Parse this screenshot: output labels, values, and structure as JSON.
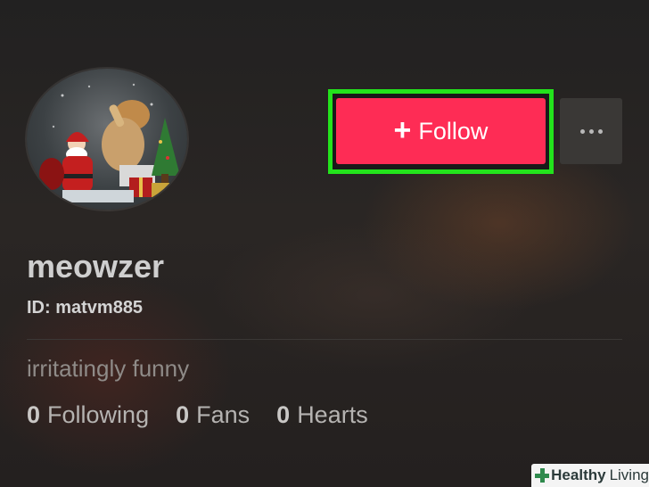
{
  "profile": {
    "username": "meowzer",
    "id_text": "ID: matvm885",
    "bio": "irritatingly funny"
  },
  "actions": {
    "follow_plus": "+",
    "follow_label": "Follow",
    "more_icon": "more-dots-icon"
  },
  "stats": [
    {
      "num": "0",
      "label": "Following"
    },
    {
      "num": "0",
      "label": "Fans"
    },
    {
      "num": "0",
      "label": "Hearts"
    }
  ],
  "watermark": {
    "brand_bold": "Healthy",
    "brand_light": "Living"
  },
  "colors": {
    "follow_button": "#fe2c55",
    "highlight_border": "#23e31c",
    "background": "#1f1d1c"
  }
}
